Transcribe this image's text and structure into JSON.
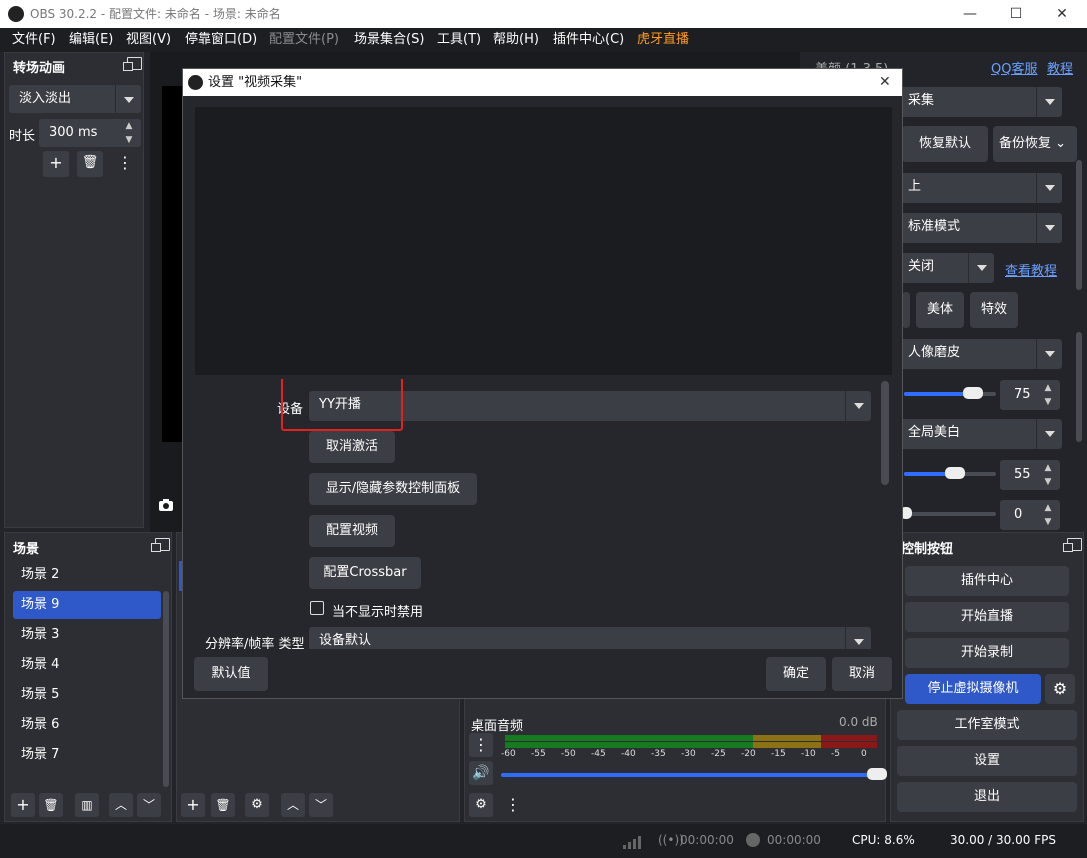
{
  "window": {
    "title": "OBS 30.2.2 - 配置文件: 未命名 - 场景: 未命名"
  },
  "menu": [
    "文件(F)",
    "编辑(E)",
    "视图(V)",
    "停靠窗口(D)",
    "配置文件(P)",
    "场景集合(S)",
    "工具(T)",
    "帮助(H)",
    "插件中心(C)",
    "虎牙直播"
  ],
  "transitions": {
    "title": "转场动画",
    "transition": "淡入淡出",
    "duration_label": "时长",
    "duration": "300 ms"
  },
  "scenes": {
    "title": "场景",
    "items": [
      "场景 2",
      "场景 9",
      "场景 3",
      "场景 4",
      "场景 5",
      "场景 6",
      "场景 7"
    ],
    "selected": 1
  },
  "beauty": {
    "title": "美颜 (1.3.5)",
    "link_qq": "QQ客服",
    "link_tutorial": "教程",
    "camera_select": "采集",
    "btn_restore": "恢复默认",
    "btn_backup": "备份恢复",
    "sel_direction": "上",
    "sel_mode": "标准模式",
    "sel_toggle": "关闭",
    "link_view_tutorial": "查看教程",
    "tab_body": "美体",
    "tab_effect": "特效",
    "sel_smooth": "人像磨皮",
    "smooth_value": "75",
    "smooth_frac": 0.75,
    "sel_white": "全局美白",
    "white_value": "55",
    "white_frac": 0.55,
    "third_value": "0"
  },
  "controls": {
    "title": "控制按钮",
    "plugin_center": "插件中心",
    "start_stream": "开始直播",
    "start_record": "开始录制",
    "stop_vcam": "停止虚拟摄像机",
    "studio_mode": "工作室模式",
    "settings": "设置",
    "exit": "退出"
  },
  "mixer": {
    "track": "桌面音频",
    "level": "0.0 dB",
    "ticks": [
      "-60",
      "-55",
      "-50",
      "-45",
      "-40",
      "-35",
      "-30",
      "-25",
      "-20",
      "-15",
      "-10",
      "-5",
      "0"
    ],
    "volume_frac": 1.0
  },
  "status": {
    "stream_time": "00:00:00",
    "rec_time": "00:00:00",
    "cpu": "CPU: 8.6%",
    "fps": "30.00 / 30.00 FPS"
  },
  "dialog": {
    "title": "设置 \"视频采集\"",
    "device_label": "设备",
    "device_value": "YY开播",
    "btn_deactivate": "取消激活",
    "btn_toggle_panel": "显示/隐藏参数控制面板",
    "btn_config_video": "配置视频",
    "btn_config_crossbar": "配置Crossbar",
    "checkbox_label": "当不显示时禁用",
    "res_label": "分辨率/帧率 类型",
    "res_value": "设备默认",
    "btn_defaults": "默认值",
    "btn_ok": "确定",
    "btn_cancel": "取消"
  },
  "colors": {
    "accent": "#2f58c8",
    "highlight_box": "#e0231f",
    "huya": "#ff9a1f"
  }
}
